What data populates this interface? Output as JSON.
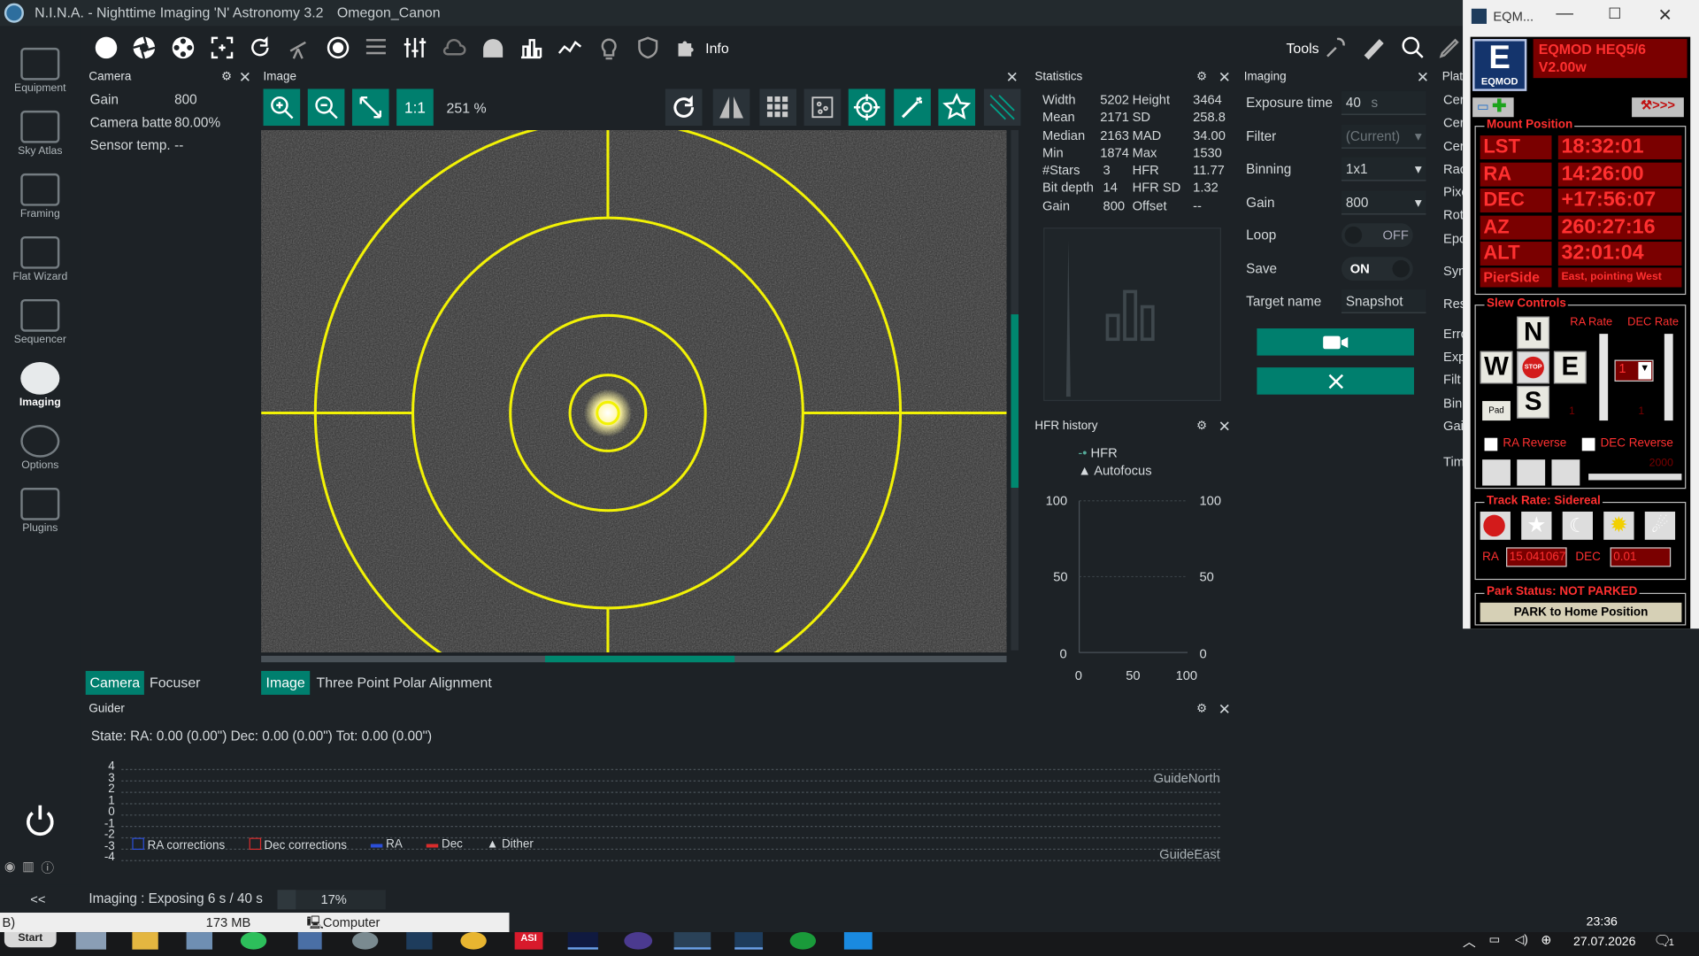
{
  "window": {
    "title": "N.I.N.A. - Nighttime Imaging 'N' Astronomy 3.2",
    "profile": "Omegon_Canon"
  },
  "toolbar": {
    "info_label": "Info",
    "tools_label": "Tools"
  },
  "sidebar": {
    "items": [
      {
        "label": "Equipment"
      },
      {
        "label": "Sky Atlas"
      },
      {
        "label": "Framing"
      },
      {
        "label": "Flat Wizard"
      },
      {
        "label": "Sequencer"
      },
      {
        "label": "Imaging"
      },
      {
        "label": "Options"
      },
      {
        "label": "Plugins"
      }
    ]
  },
  "camera_panel": {
    "title": "Camera",
    "rows": [
      {
        "label": "Gain",
        "value": "800"
      },
      {
        "label": "Camera batte",
        "value": "80.00%"
      },
      {
        "label": "Sensor temp.",
        "value": "--"
      }
    ],
    "tabs": [
      "Camera",
      "Focuser"
    ]
  },
  "image_panel": {
    "title": "Image",
    "zoom_ratio_label": "1:1",
    "zoom_percent": "251 %",
    "tabs": [
      "Image",
      "Three Point Polar Alignment"
    ]
  },
  "statistics": {
    "title": "Statistics",
    "left": [
      {
        "label": "Width",
        "value": "5202"
      },
      {
        "label": "Mean",
        "value": "2171"
      },
      {
        "label": "Median",
        "value": "2163"
      },
      {
        "label": "Min",
        "value": "1874"
      },
      {
        "label": "#Stars",
        "value": "3"
      },
      {
        "label": "Bit depth",
        "value": "14"
      },
      {
        "label": "Gain",
        "value": "800"
      }
    ],
    "right": [
      {
        "label": "Height",
        "value": "3464"
      },
      {
        "label": "SD",
        "value": "258.8"
      },
      {
        "label": "MAD",
        "value": "34.00"
      },
      {
        "label": "Max",
        "value": "1530"
      },
      {
        "label": "HFR",
        "value": "11.77"
      },
      {
        "label": "HFR SD",
        "value": "1.32"
      },
      {
        "label": "Offset",
        "value": "--"
      }
    ]
  },
  "hfr_history": {
    "title": "HFR history",
    "legend": [
      "HFR",
      "Autofocus"
    ],
    "y_ticks": [
      "100",
      "50",
      "0"
    ],
    "x_ticks": [
      "0",
      "50",
      "100"
    ]
  },
  "imaging": {
    "title": "Imaging",
    "exposure_label": "Exposure time",
    "exposure_value": "40",
    "exposure_unit": "s",
    "filter_label": "Filter",
    "filter_value": "(Current)",
    "binning_label": "Binning",
    "binning_value": "1x1",
    "gain_label": "Gain",
    "gain_value": "800",
    "loop_label": "Loop",
    "loop_value": "OFF",
    "save_label": "Save",
    "save_value": "ON",
    "target_label": "Target name",
    "target_value": "Snapshot"
  },
  "plate_partial": {
    "title": "Plate",
    "rows": [
      "Cer",
      "Cer",
      "Cer",
      "Rac",
      "Pixe",
      "Rot",
      "Epc",
      "Syn",
      "Res",
      "Erro",
      "Exp",
      "Filt",
      "Bin",
      "Gai",
      "Tim"
    ]
  },
  "guider": {
    "title": "Guider",
    "state_text": "State:  RA: 0.00 (0.00\")  Dec: 0.00 (0.00\")  Tot: 0.00 (0.00\")",
    "y_ticks": [
      "4",
      "3",
      "2",
      "1",
      "0",
      "-1",
      "-2",
      "-3",
      "-4"
    ],
    "label_north": "GuideNorth",
    "label_east": "GuideEast",
    "legend": [
      "RA corrections",
      "Dec corrections",
      "RA",
      "Dec",
      "Dither"
    ]
  },
  "statusbar": {
    "collapse": "<<",
    "status": "Imaging :  Exposing 6 s / 40 s",
    "progress_text": "17%",
    "progress": 0.17
  },
  "popup_strip": {
    "left": "B)",
    "memory": "173 MB",
    "computer": "Computer"
  },
  "eqmod": {
    "window_title": "EQM...",
    "logo_text": "EQMOD",
    "mount_name": "EQMOD HEQ5/6",
    "version": "V2.00w",
    "mount_position_title": "Mount Position",
    "lst_label": "LST",
    "lst_value": "18:32:01",
    "ra_label": "RA",
    "ra_value": "14:26:00",
    "dec_label": "DEC",
    "dec_value": "+17:56:07",
    "az_label": "AZ",
    "az_value": "260:27:16",
    "alt_label": "ALT",
    "alt_value": "32:01:04",
    "pierside_label": "PierSide",
    "pierside_value": "East, pointing West",
    "slew_title": "Slew Controls",
    "ra_rate_label": "RA Rate",
    "dec_rate_label": "DEC Rate",
    "n": "N",
    "s": "S",
    "e": "E",
    "w": "W",
    "stop": "STOP",
    "pad": "Pad",
    "rate_value": "1",
    "ra_reverse": "RA Reverse",
    "dec_reverse": "DEC Reverse",
    "slider_value": "2000",
    "track_title": "Track Rate: Sidereal",
    "track_ra_label": "RA",
    "track_ra_value": "15.041067",
    "track_dec_label": "DEC",
    "track_dec_value": "0.01",
    "park_title": "Park Status: NOT PARKED",
    "park_button": "PARK to Home Position"
  },
  "taskbar": {
    "start": "Start",
    "time": "23:36",
    "date": "27.07.2026",
    "notif_count": "1"
  }
}
